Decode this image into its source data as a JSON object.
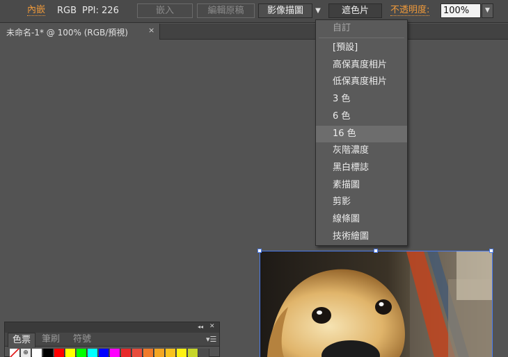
{
  "control_bar": {
    "embedded_link": "內嵌",
    "color_mode": "RGB",
    "ppi": "PPI: 226",
    "embed_button": "嵌入",
    "edit_original_button": "編輯原稿",
    "image_trace_button": "影像描圖",
    "preset_arrow": "▼",
    "mask_button": "遮色片",
    "opacity_label": "不透明度:",
    "opacity_value": "100%",
    "opacity_arrow": "▼"
  },
  "document_tab": {
    "title": "未命名-1* @ 100% (RGB/預視)",
    "close": "×"
  },
  "trace_preset_menu": {
    "items": [
      {
        "label": "自訂",
        "state": "disabled"
      },
      {
        "label": "[預設]"
      },
      {
        "label": "高保真度相片"
      },
      {
        "label": "低保真度相片"
      },
      {
        "label": "3 色"
      },
      {
        "label": "6 色"
      },
      {
        "label": "16 色",
        "state": "highlighted"
      },
      {
        "label": "灰階濃度"
      },
      {
        "label": "黑白標誌"
      },
      {
        "label": "素描圖"
      },
      {
        "label": "剪影"
      },
      {
        "label": "線條圖"
      },
      {
        "label": "技術繪圖"
      }
    ]
  },
  "swatches_panel": {
    "collapse_icon": "◂◂",
    "close_icon": "✕",
    "menu_icon": "▾☰",
    "tabs": [
      {
        "label": "色票",
        "active": true
      },
      {
        "label": "筆刷"
      },
      {
        "label": "符號"
      }
    ],
    "swatch_colors": [
      "#ffffff",
      "#000000",
      "#ff0000",
      "#ffff00",
      "#00ff00",
      "#00ffff",
      "#0000ff",
      "#ff00ff",
      "#e8282a",
      "#e84c3c",
      "#f07a2a",
      "#f4a622",
      "#f8c21e",
      "#fff212",
      "#c7d62a",
      "#4b4b4b"
    ]
  },
  "placed_image": {
    "description_icon": "photo-icon"
  },
  "colors": {
    "accent_orange": "#f09a3a",
    "selection_blue": "#4a7cf0",
    "menu_bg": "#5a5a5a",
    "menu_highlight": "#6d6d6d"
  }
}
